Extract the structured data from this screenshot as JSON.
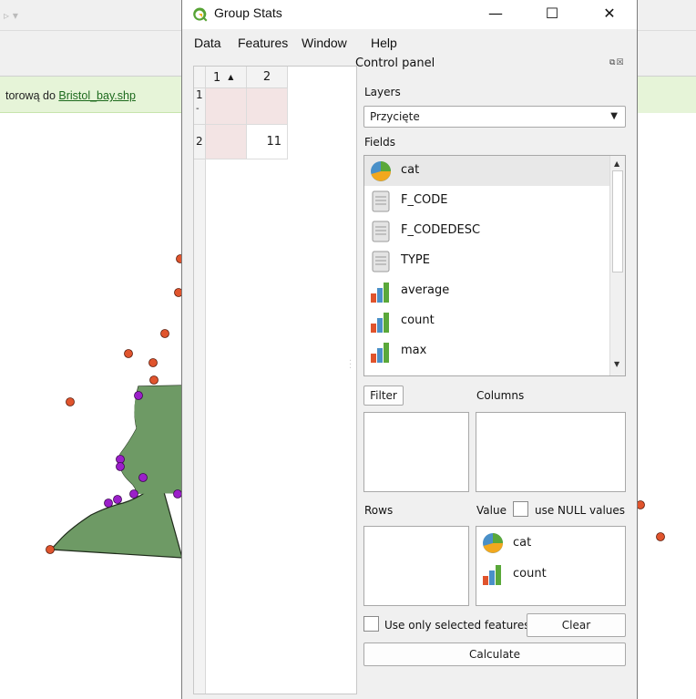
{
  "background": {
    "message_prefix": "torową do ",
    "message_link": "Bristol_bay.shp",
    "colors": {
      "land": "#6e9a65",
      "point_red": "#e0542d",
      "point_purple": "#9b1fc9"
    }
  },
  "window": {
    "title": "Group Stats",
    "controls": {
      "minimize": "—",
      "maximize": "☐",
      "close": "✕"
    }
  },
  "menu": {
    "items": [
      "Data",
      "Features",
      "Window",
      "Help"
    ]
  },
  "table": {
    "columns": [
      "1",
      "2"
    ],
    "rows": [
      {
        "header": "1",
        "values": [
          "",
          ""
        ]
      },
      {
        "header": "2",
        "values": [
          "",
          "11"
        ]
      }
    ]
  },
  "control_panel": {
    "title": "Control panel",
    "layers_label": "Layers",
    "layer_selected": "Przycięte",
    "fields_label": "Fields",
    "fields": [
      {
        "name": "cat",
        "icon": "pie-icon"
      },
      {
        "name": "F_CODE",
        "icon": "text-field-icon"
      },
      {
        "name": "F_CODEDESC",
        "icon": "text-field-icon"
      },
      {
        "name": "TYPE",
        "icon": "text-field-icon"
      },
      {
        "name": "average",
        "icon": "bar-chart-icon"
      },
      {
        "name": "count",
        "icon": "bar-chart-icon"
      },
      {
        "name": "max",
        "icon": "bar-chart-icon"
      }
    ],
    "filter_label": "Filter",
    "columns_label": "Columns",
    "rows_label": "Rows",
    "value_label": "Value",
    "null_values_label": "use NULL values",
    "value_items": [
      {
        "name": "cat",
        "icon": "pie-icon"
      },
      {
        "name": "count",
        "icon": "bar-chart-icon"
      }
    ],
    "selected_only_label": "Use only selected features",
    "clear_label": "Clear",
    "calculate_label": "Calculate"
  }
}
